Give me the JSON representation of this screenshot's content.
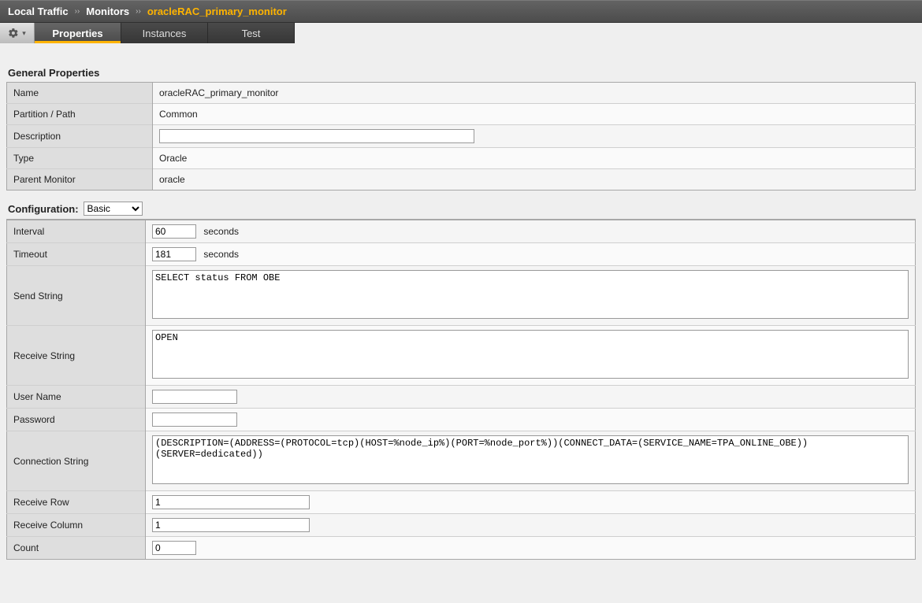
{
  "breadcrumb": {
    "root": "Local Traffic",
    "mid": "Monitors",
    "current": "oracleRAC_primary_monitor"
  },
  "tabs": {
    "properties": "Properties",
    "instances": "Instances",
    "test": "Test"
  },
  "sections": {
    "general": "General Properties",
    "configuration_label": "Configuration:"
  },
  "config_select": {
    "selected": "Basic"
  },
  "general": {
    "rows": {
      "name": {
        "label": "Name",
        "value": "oracleRAC_primary_monitor"
      },
      "partition": {
        "label": "Partition / Path",
        "value": "Common"
      },
      "description": {
        "label": "Description",
        "value": ""
      },
      "type": {
        "label": "Type",
        "value": "Oracle"
      },
      "parent": {
        "label": "Parent Monitor",
        "value": "oracle"
      }
    }
  },
  "configuration": {
    "interval": {
      "label": "Interval",
      "value": "60",
      "unit": "seconds"
    },
    "timeout": {
      "label": "Timeout",
      "value": "181",
      "unit": "seconds"
    },
    "send_string": {
      "label": "Send String",
      "value": "SELECT status FROM OBE"
    },
    "receive_string": {
      "label": "Receive String",
      "value": "OPEN"
    },
    "username": {
      "label": "User Name",
      "value": ""
    },
    "password": {
      "label": "Password",
      "value": ""
    },
    "connection_string": {
      "label": "Connection String",
      "value": "(DESCRIPTION=(ADDRESS=(PROTOCOL=tcp)(HOST=%node_ip%)(PORT=%node_port%))(CONNECT_DATA=(SERVICE_NAME=TPA_ONLINE_OBE))(SERVER=dedicated))"
    },
    "receive_row": {
      "label": "Receive Row",
      "value": "1"
    },
    "receive_column": {
      "label": "Receive Column",
      "value": "1"
    },
    "count": {
      "label": "Count",
      "value": "0"
    }
  }
}
